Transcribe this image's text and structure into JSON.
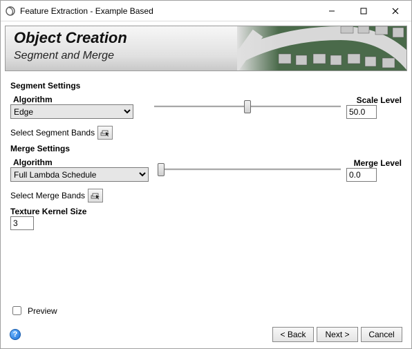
{
  "window": {
    "title": "Feature Extraction - Example Based"
  },
  "banner": {
    "title": "Object Creation",
    "subtitle": "Segment and Merge"
  },
  "segment": {
    "section_title": "Segment Settings",
    "algo_label": "Algorithm",
    "algo_value": "Edge",
    "scale_label": "Scale Level",
    "scale_value": "50.0",
    "scale_fraction": 0.5,
    "select_bands_label": "Select Segment Bands"
  },
  "merge": {
    "section_title": "Merge Settings",
    "algo_label": "Algorithm",
    "algo_value": "Full Lambda Schedule",
    "level_label": "Merge Level",
    "level_value": "0.0",
    "level_fraction": 0.0,
    "select_bands_label": "Select Merge Bands"
  },
  "texture": {
    "label": "Texture Kernel Size",
    "value": "3"
  },
  "footer": {
    "preview_label": "Preview",
    "preview_checked": false,
    "help_text": "?",
    "back_label": "< Back",
    "next_label": "Next >",
    "cancel_label": "Cancel"
  }
}
